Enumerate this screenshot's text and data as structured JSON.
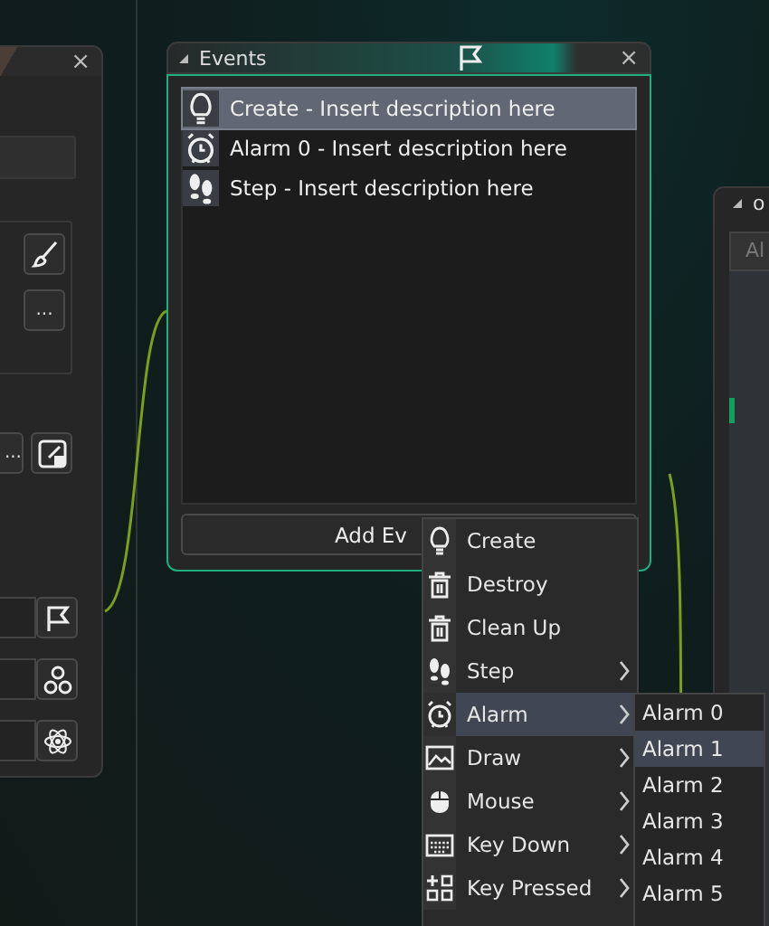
{
  "left_panel": {
    "close": "×",
    "dots_buttons": [
      "...",
      "..."
    ]
  },
  "events_window": {
    "title": "Events",
    "close": "×",
    "items": [
      {
        "label": "Create - Insert description here",
        "selected": true
      },
      {
        "label": "Alarm 0 - Insert description here",
        "selected": false
      },
      {
        "label": "Step - Insert description here",
        "selected": false
      }
    ],
    "add_button": "Add Ev"
  },
  "right_window": {
    "title": "o",
    "tab": "Al"
  },
  "context_menu": {
    "items": [
      {
        "label": "Create",
        "submenu": false,
        "selected": false
      },
      {
        "label": "Destroy",
        "submenu": false,
        "selected": false
      },
      {
        "label": "Clean Up",
        "submenu": false,
        "selected": false
      },
      {
        "label": "Step",
        "submenu": true,
        "selected": false
      },
      {
        "label": "Alarm",
        "submenu": true,
        "selected": true
      },
      {
        "label": "Draw",
        "submenu": true,
        "selected": false
      },
      {
        "label": "Mouse",
        "submenu": true,
        "selected": false
      },
      {
        "label": "Key Down",
        "submenu": true,
        "selected": false
      },
      {
        "label": "Key Pressed",
        "submenu": true,
        "selected": false
      }
    ]
  },
  "submenu": {
    "items": [
      {
        "label": "Alarm 0",
        "selected": false
      },
      {
        "label": "Alarm 1",
        "selected": true
      },
      {
        "label": "Alarm 2",
        "selected": false
      },
      {
        "label": "Alarm 3",
        "selected": false
      },
      {
        "label": "Alarm 4",
        "selected": false
      },
      {
        "label": "Alarm 5",
        "selected": false
      }
    ]
  }
}
